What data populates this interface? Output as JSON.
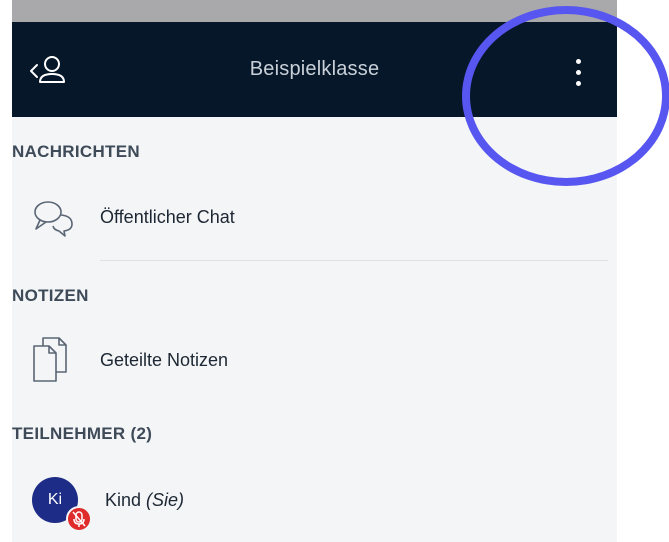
{
  "header": {
    "title": "Beispielklasse",
    "back_icon": "back-user-icon",
    "menu_icon": "more-vertical-icon"
  },
  "sections": {
    "messages": {
      "label": "NACHRICHTEN",
      "items": [
        {
          "label": "Öffentlicher Chat",
          "icon": "chat-bubbles-icon"
        }
      ]
    },
    "notes": {
      "label": "NOTIZEN",
      "items": [
        {
          "label": "Geteilte Notizen",
          "icon": "documents-icon"
        }
      ]
    },
    "participants": {
      "label": "TEILNEHMER (2)",
      "users": [
        {
          "initials": "Ki",
          "name": "Kind",
          "self_label": "(Sie)",
          "status_icon": "muted-microphone-icon"
        }
      ]
    }
  },
  "colors": {
    "header_bg": "#06172a",
    "panel_bg": "#f3f5f7",
    "avatar_bg": "#1d2c86",
    "mute_badge": "#e02b2b",
    "highlight": "#5756f0"
  }
}
